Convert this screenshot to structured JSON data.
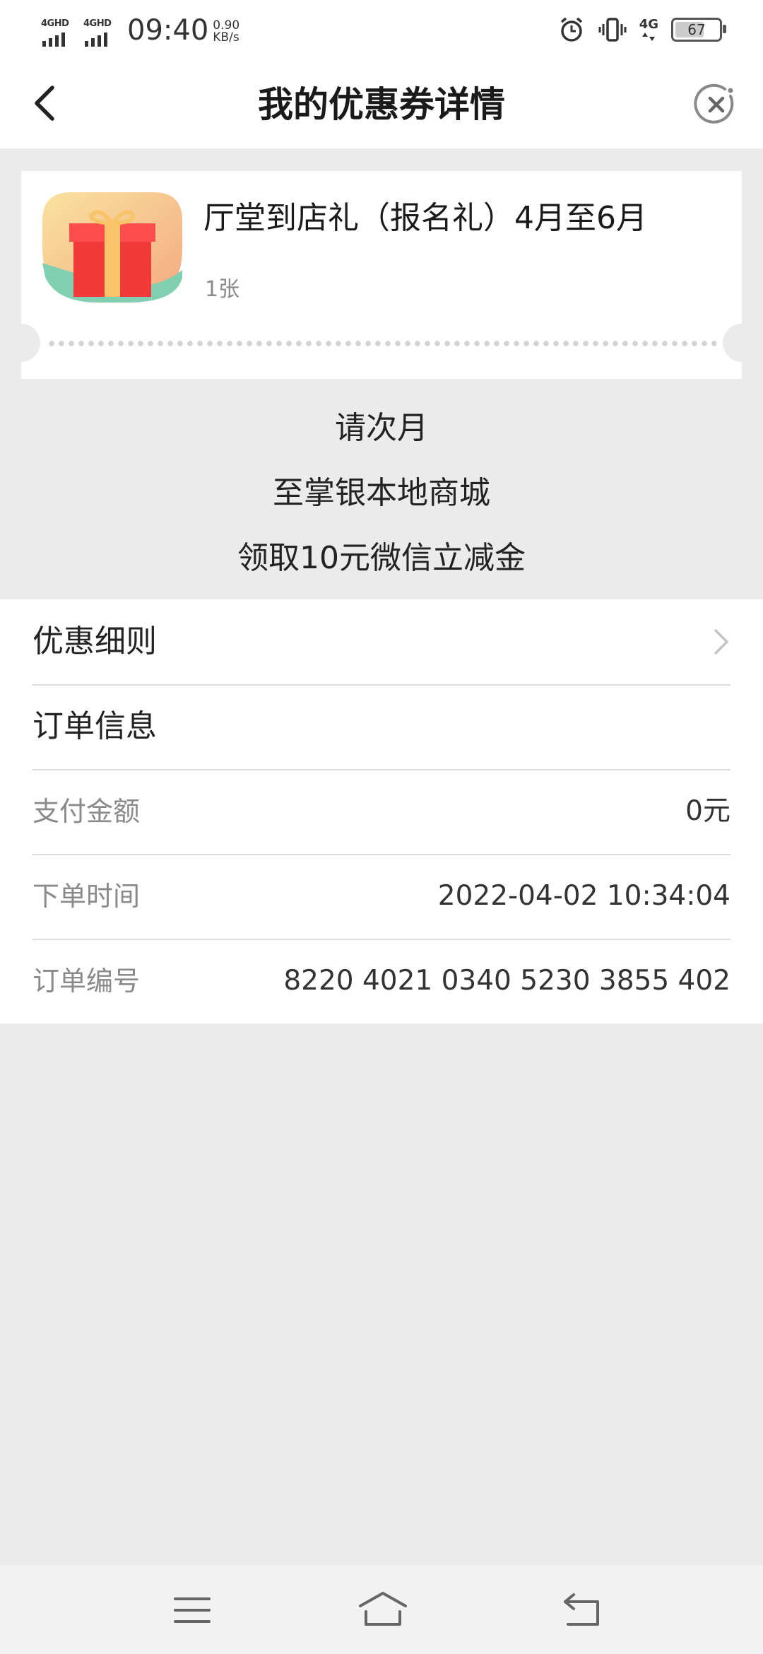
{
  "status_bar": {
    "sim1_label": "4GHD",
    "sim2_label": "4GHD",
    "time": "09:40",
    "net_speed_value": "0.90",
    "net_speed_unit": "KB/s",
    "network_type": "4G",
    "battery": "67",
    "icons": [
      "alarm-icon",
      "vibrate-icon",
      "mobile-data-icon",
      "battery-icon"
    ]
  },
  "nav": {
    "title": "我的优惠券详情",
    "back_icon": "chevron-left-icon",
    "close_icon": "close-circle-icon"
  },
  "coupon": {
    "title": "厅堂到店礼（报名礼）4月至6月",
    "count": "1张",
    "image_icon": "gift-box-icon"
  },
  "instructions": [
    "请次月",
    "至掌银本地商城",
    "领取10元微信立减金"
  ],
  "details": {
    "rules_label": "优惠细则",
    "order_info_label": "订单信息",
    "rows": [
      {
        "label": "支付金额",
        "value": "0元"
      },
      {
        "label": "下单时间",
        "value": "2022-04-02 10:34:04"
      },
      {
        "label": "订单编号",
        "value": "8220 4021 0340 5230 3855 402"
      }
    ]
  },
  "system_nav": {
    "icons": [
      "menu-icon",
      "home-icon",
      "back-icon"
    ]
  },
  "colors": {
    "page_background": "#ebebeb",
    "card_background": "#ffffff",
    "gift_red": "#f23a3a",
    "gift_ribbon": "#f7c46a",
    "gift_bg_green": "#7fcfb0",
    "gift_bg_orange": "#f6b888"
  }
}
